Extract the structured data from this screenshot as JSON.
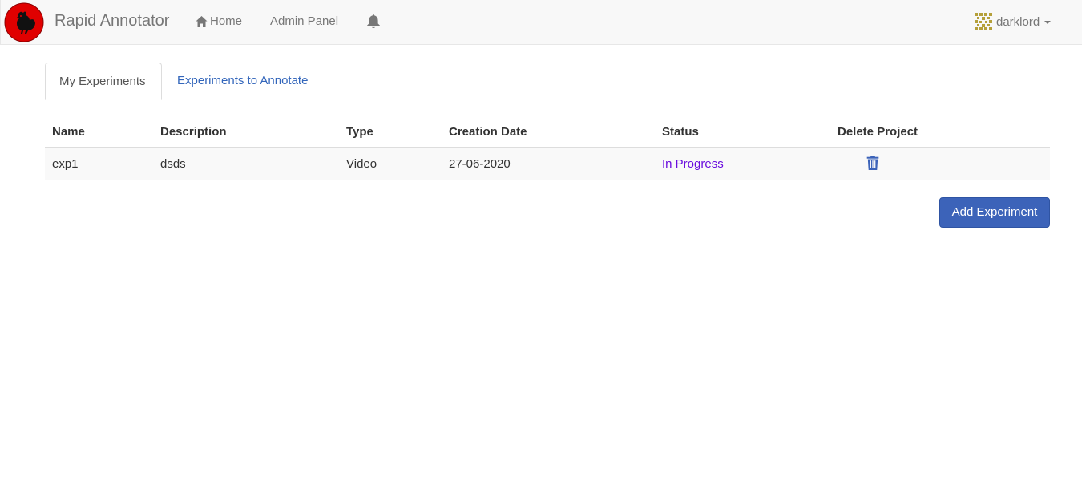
{
  "navbar": {
    "brand": "Rapid Annotator",
    "logo_icon": "rooster-logo-icon",
    "home_label": "Home",
    "admin_label": "Admin Panel",
    "user_name": "darklord",
    "colors": {
      "background": "#f8f8f8",
      "text": "#777777",
      "logo_red": "#e00000"
    }
  },
  "tabs": [
    {
      "label": "My Experiments",
      "active": true
    },
    {
      "label": "Experiments to Annotate",
      "active": false
    }
  ],
  "table": {
    "headers": [
      "Name",
      "Description",
      "Type",
      "Creation Date",
      "Status",
      "Delete Project"
    ],
    "rows": [
      {
        "name": "exp1",
        "description": "dsds",
        "type": "Video",
        "creation_date": "27-06-2020",
        "status": "In Progress",
        "delete_icon": "trash-icon"
      }
    ],
    "status_color": "#6a0dde"
  },
  "actions": {
    "add_label": "Add Experiment",
    "button_color": "#3c63b9"
  }
}
